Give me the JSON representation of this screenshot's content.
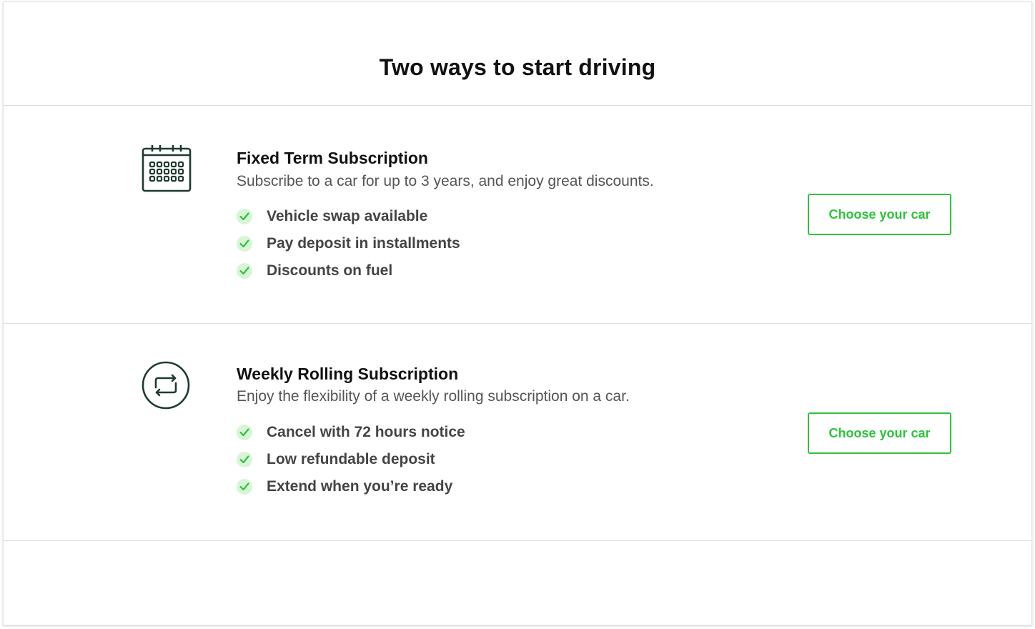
{
  "page": {
    "title": "Two ways to start driving"
  },
  "plans": [
    {
      "icon": "calendar-icon",
      "title": "Fixed Term Subscription",
      "description": "Subscribe to a car for up to 3 years, and enjoy great discounts.",
      "features": [
        "Vehicle swap available",
        "Pay deposit in installments",
        "Discounts on fuel"
      ],
      "cta_label": "Choose your car"
    },
    {
      "icon": "repeat-icon",
      "title": "Weekly Rolling Subscription",
      "description": "Enjoy the flexibility of a weekly rolling subscription on a car.",
      "features": [
        "Cancel with 72 hours notice",
        "Low refundable deposit",
        "Extend when you’re ready"
      ],
      "cta_label": "Choose your car"
    }
  ],
  "colors": {
    "accent": "#2ec33b",
    "check_background": "#d8f5d7",
    "icon_stroke": "#1f3a2e",
    "heading": "#111111",
    "body_text": "#555555",
    "feature_text": "#444444",
    "divider": "#dddddd"
  }
}
